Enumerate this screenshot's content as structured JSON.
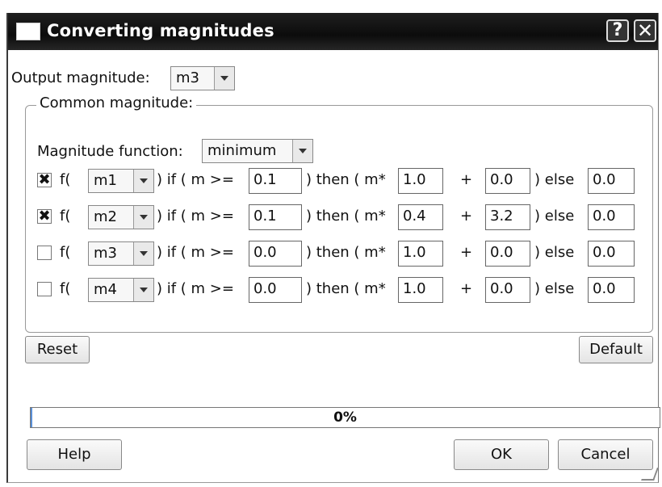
{
  "window": {
    "title": "Converting magnitudes",
    "help_glyph": "?",
    "close_glyph": "✕"
  },
  "output": {
    "label": "Output magnitude:",
    "value": "m3"
  },
  "common": {
    "title": "Common magnitude:",
    "function_label": "Magnitude function:",
    "function_value": "minimum",
    "rows": [
      {
        "checked": true,
        "check_glyph": "✖",
        "magnitude": "m1",
        "threshold": "0.1",
        "mult": "1.0",
        "add": "0.0",
        "else": "0.0"
      },
      {
        "checked": true,
        "check_glyph": "✖",
        "magnitude": "m2",
        "threshold": "0.1",
        "mult": "0.4",
        "add": "3.2",
        "else": "0.0"
      },
      {
        "checked": false,
        "check_glyph": "",
        "magnitude": "m3",
        "threshold": "0.0",
        "mult": "1.0",
        "add": "0.0",
        "else": "0.0"
      },
      {
        "checked": false,
        "check_glyph": "",
        "magnitude": "m4",
        "threshold": "0.0",
        "mult": "1.0",
        "add": "0.0",
        "else": "0.0"
      }
    ],
    "text": {
      "f_open": "f(",
      "if_cond": ") if ( m >=",
      "then": ") then ( m*",
      "plus": "+",
      "else": ") else"
    }
  },
  "buttons": {
    "reset": "Reset",
    "default": "Default",
    "help": "Help",
    "ok": "OK",
    "cancel": "Cancel"
  },
  "progress": {
    "value": 0,
    "text": "0%",
    "fill_color": "#5a8fd6"
  }
}
